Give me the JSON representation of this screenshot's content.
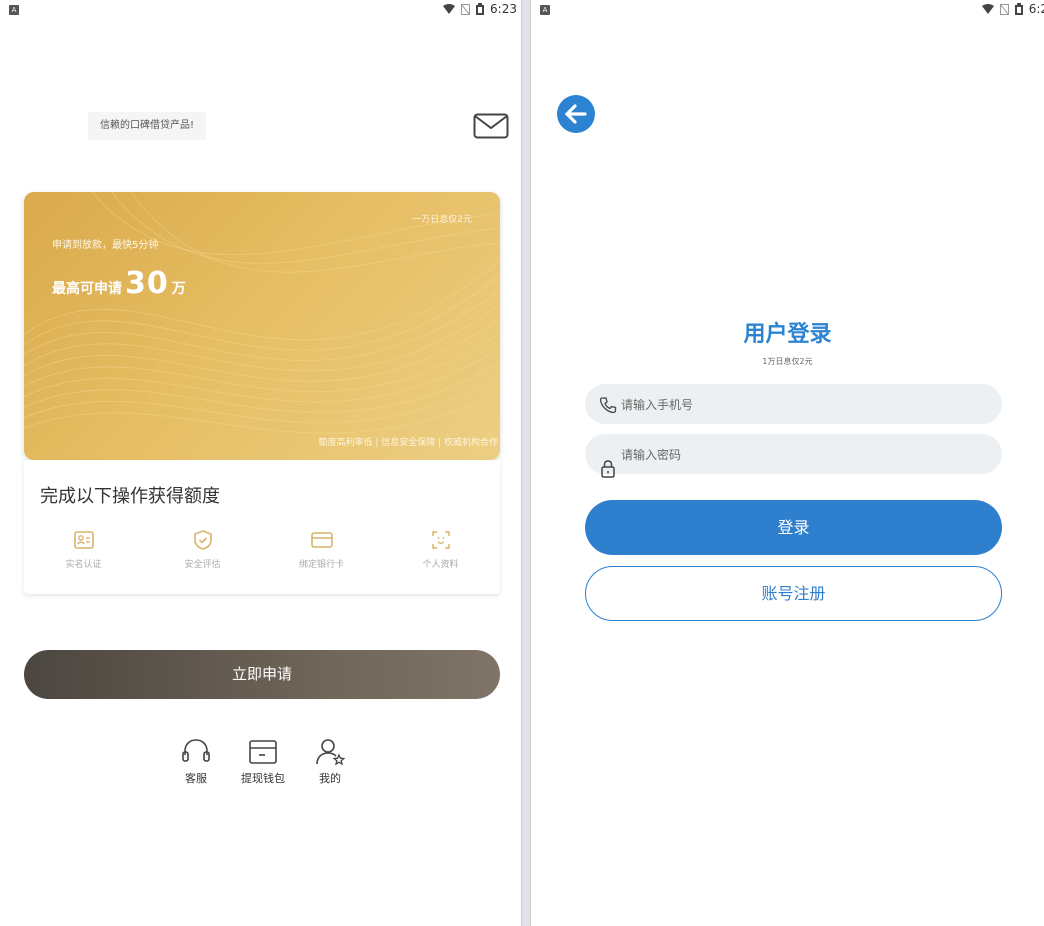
{
  "left_screen": {
    "statusbar": {
      "badge": "A",
      "time": "6:23"
    },
    "header": {
      "slogan": "信赖的口碑借贷产品!",
      "icon": "mail-icon"
    },
    "card": {
      "top_right": "一万日息仅2元",
      "subtitle": "申请到放款，最快5分钟",
      "max_prefix": "最高可申请",
      "max_amount": "30",
      "max_unit": "万",
      "footer": "额度高利率低 | 信息安全保障 | 权威机构合作",
      "colors": {
        "gold_start": "#d9a94c",
        "gold_end": "#eccf84"
      }
    },
    "ops": {
      "title": "完成以下操作获得额度",
      "items": [
        {
          "label": "实名认证",
          "icon": "id-card-icon"
        },
        {
          "label": "安全评估",
          "icon": "shield-check-icon"
        },
        {
          "label": "绑定银行卡",
          "icon": "bank-card-icon"
        },
        {
          "label": "个人资料",
          "icon": "face-scan-icon"
        }
      ],
      "icon_color": "#d9b46a"
    },
    "apply_button": "立即申请",
    "bottom_nav": [
      {
        "label": "客服",
        "icon": "headset-icon"
      },
      {
        "label": "提现钱包",
        "icon": "wallet-icon"
      },
      {
        "label": "我的",
        "icon": "user-star-icon"
      }
    ]
  },
  "right_screen": {
    "statusbar": {
      "badge": "A",
      "time": "6:2"
    },
    "back_icon": "arrow-left-icon",
    "title": "用户登录",
    "subtitle": "1万日息仅2元",
    "phone_input": {
      "placeholder": "请输入手机号",
      "icon": "phone-icon"
    },
    "password_input": {
      "placeholder": "请输入密码",
      "icon": "lock-icon"
    },
    "login_button": "登录",
    "register_button": "账号注册",
    "accent_color": "#2b83d1"
  }
}
